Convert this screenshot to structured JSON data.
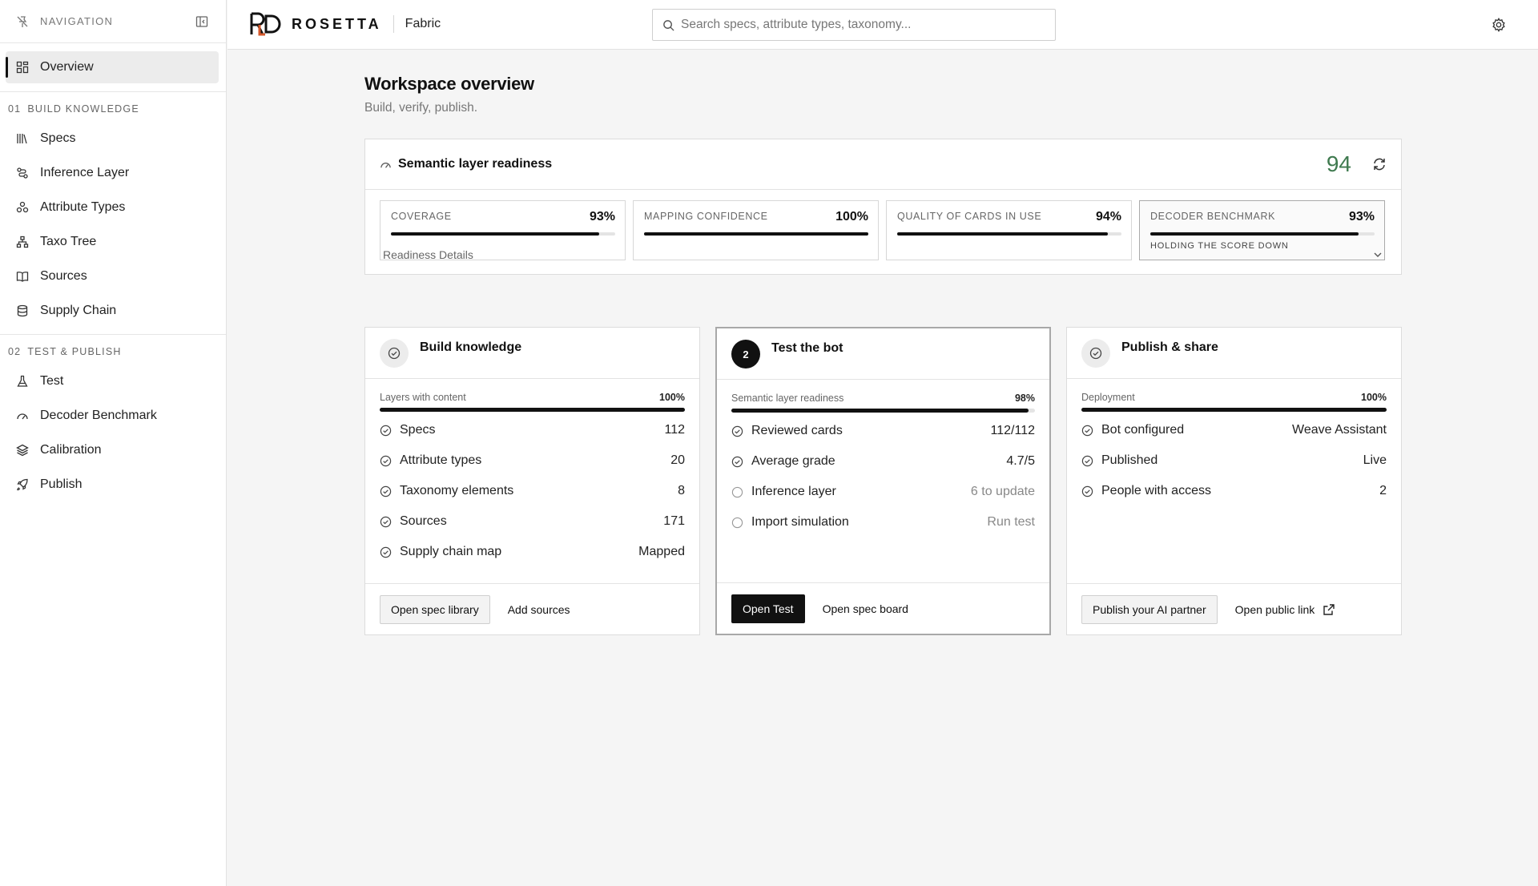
{
  "sidebar": {
    "title": "NAVIGATION",
    "overview": "Overview",
    "section1": {
      "num": "01",
      "label": "BUILD KNOWLEDGE"
    },
    "section1_items": [
      "Specs",
      "Inference Layer",
      "Attribute Types",
      "Taxo Tree",
      "Sources",
      "Supply Chain"
    ],
    "section2": {
      "num": "02",
      "label": "TEST & PUBLISH"
    },
    "section2_items": [
      "Test",
      "Decoder Benchmark",
      "Calibration",
      "Publish"
    ]
  },
  "header": {
    "brand": "ROSETTA",
    "workspace": "Fabric",
    "search_placeholder": "Search specs, attribute types, taxonomy..."
  },
  "page": {
    "title": "Workspace overview",
    "subtitle": "Build, verify, publish."
  },
  "readiness": {
    "label": "Semantic layer readiness",
    "score": "94",
    "score_color": "#3f7a4f",
    "details_label": "Readiness Details",
    "metrics": [
      {
        "label": "COVERAGE",
        "value": "93%",
        "fill": 0.93,
        "note": ""
      },
      {
        "label": "MAPPING CONFIDENCE",
        "value": "100%",
        "fill": 1.0,
        "note": ""
      },
      {
        "label": "QUALITY OF CARDS IN USE",
        "value": "94%",
        "fill": 0.94,
        "note": ""
      },
      {
        "label": "DECODER BENCHMARK",
        "value": "93%",
        "fill": 0.93,
        "note": "HOLDING THE SCORE DOWN"
      }
    ]
  },
  "cards": [
    {
      "title": "Build knowledge",
      "badge": "",
      "progress_label": "Layers with content",
      "progress_value": "100%",
      "progress_fill": 1.0,
      "rows": [
        {
          "label": "Specs",
          "value": "112",
          "done": true
        },
        {
          "label": "Attribute types",
          "value": "20",
          "done": true
        },
        {
          "label": "Taxonomy elements",
          "value": "8",
          "done": true
        },
        {
          "label": "Sources",
          "value": "171",
          "done": true
        },
        {
          "label": "Supply chain map",
          "value": "Mapped",
          "done": true
        }
      ],
      "primary": "Open spec library",
      "secondary": "Add sources"
    },
    {
      "title": "Test the bot",
      "badge": "2",
      "progress_label": "Semantic layer readiness",
      "progress_value": "98%",
      "progress_fill": 0.98,
      "rows": [
        {
          "label": "Reviewed cards",
          "value": "112/112",
          "done": true
        },
        {
          "label": "Average grade",
          "value": "4.7/5",
          "done": true
        },
        {
          "label": "Inference layer",
          "value": "6 to update",
          "done": false
        },
        {
          "label": "Import simulation",
          "value": "Run test",
          "done": false
        }
      ],
      "primary": "Open Test",
      "secondary": "Open spec board"
    },
    {
      "title": "Publish & share",
      "badge": "",
      "progress_label": "Deployment",
      "progress_value": "100%",
      "progress_fill": 1.0,
      "rows": [
        {
          "label": "Bot configured",
          "value": "Weave Assistant",
          "done": true
        },
        {
          "label": "Published",
          "value": "Live",
          "done": true
        },
        {
          "label": "People with access",
          "value": "2",
          "done": true
        }
      ],
      "primary": "Publish your AI partner",
      "secondary": "Open public link"
    }
  ]
}
